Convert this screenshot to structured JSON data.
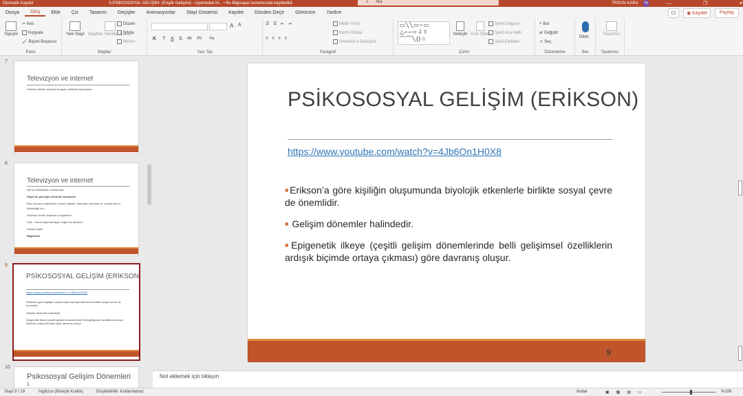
{
  "titlebar": {
    "autosave": "Otomatik Kaydet",
    "doc_title": "5.PSİKOSOSYAL GELİŞİM- (Erişilir Gelişimi) - Uyumluluk M... • Bu Bilgisayar konumunda kaydedildi",
    "search_placeholder": "Ara",
    "user": "TRSUN KARA",
    "avatar_initials": "TK",
    "window_controls": "—  ❐  ✕"
  },
  "menu": {
    "tabs": [
      "Dosya",
      "Giriş",
      "Ekle",
      "Çiz",
      "Tasarım",
      "Geçişler",
      "Animasyonlar",
      "Slayt Gösterisi",
      "Kaydet",
      "Gözden Geçir",
      "Görünüm",
      "Yardım"
    ],
    "active_index": 1,
    "comment_label": "☐",
    "record_label": "◉ Kaydet",
    "share_label": "Paylaş"
  },
  "ribbon": {
    "pano": {
      "label": "Pano",
      "paste": "Yapıştır",
      "cut": "Kes",
      "copy": "Kopyala",
      "format_painter": "Biçimi Boyacısı"
    },
    "slaytlar": {
      "label": "Slaytlar",
      "new_slide": "Yeni Slayt",
      "reuse": "Slaytları Yeniden Kullan",
      "layout": "Düzen",
      "reset": "Sıfırla",
      "section": "Bölüm"
    },
    "yazi_tipi": {
      "label": "Yazı Tipi",
      "font_size_up": "A",
      "font_size_down": "A",
      "bold": "K",
      "italic": "T",
      "underline": "A",
      "strike": "S",
      "shadow": "ab",
      "spacing": "AV",
      "case": "Aa"
    },
    "paragraf": {
      "label": "Paragraf",
      "text_direction": "Metin Yönü",
      "align_text": "Metni Hizala",
      "smartart": "SmartArt'a Dönüştür"
    },
    "cizim": {
      "label": "Çizim",
      "shapes": "▭╲╲▭○▭\n△⌐⌐⇨⇩⇧\n⌒⌒╲{}☆",
      "arrange": "Yerleştir",
      "quick_styles": "Hızlı Stiller",
      "shape_fill": "Şekil Dolgusu",
      "shape_outline": "Şekil Ana Hattı",
      "shape_effects": "Şekil Efektleri"
    },
    "duzenleme": {
      "label": "Düzenleme",
      "find": "Bul",
      "replace": "Değiştir",
      "select": "Seç"
    },
    "ses": {
      "label": "Ses",
      "dictate": "Dikte"
    },
    "tasarimci": {
      "label": "Tasarımcı",
      "designer": "Tasarımcı"
    }
  },
  "thumbnails": [
    {
      "number": "7",
      "title": "Televizyon ve internet",
      "lines": [
        "Yetersiz aktivite hareket olmayan etkileşim kavramları"
      ],
      "selected": false
    },
    {
      "number": "8",
      "title": "Televizyon ve internet",
      "lines": [
        "Aile içi etkileşimin sınırlanması",
        "Hayal ile gerçeğin zihninde karışması",
        "Bazı olumsuz eğitimlerin sınırsız (şiddet, stereotip, işmeyen vs. sosyal beceri düşüklüğü vb.)",
        "Olumsuz örnek oluşturan programlar",
        "Hızlı - Hazır hayat almayan doğurucu aktarımı",
        "Zaman kaybı",
        "Bağımlılık"
      ],
      "selected": false
    },
    {
      "number": "9",
      "title": "PSİKOSOSYAL GELİŞİM (ERİKSON)",
      "lines": [
        "https://www.youtube.com/watch?v=4Jb6On1H0X8",
        "Erikson'a göre kişiliğin oluşumunda biyolojik etkenlerle birlikte sosyal çevre de önemlidir.",
        "Gelişim dönemler halindedir.",
        "Epigenetik ilkeye (çeşitli gelişim dönemlerinde belli gelişimsel özelliklerin ardışık biçimde ortaya çıkması) göre davranış oluşur."
      ],
      "selected": true
    },
    {
      "number": "10",
      "title": "Psikososyal Gelişim Dönemleri",
      "lines": [
        "1"
      ],
      "selected": false
    }
  ],
  "slide": {
    "title": "PSİKOSOSYAL GELİŞİM (ERİKSON)",
    "link": "https://www.youtube.com/watch?v=4Jb6On1H0X8",
    "bullets": [
      "Erikson’a göre kişiliğin oluşumunda biyolojik etkenlerle birlikte sosyal çevre de önemlidir.",
      "Gelişim dönemler halindedir.",
      "Epigenetik ilkeye (çeşitli gelişim dönemlerinde belli gelişimsel özelliklerin ardışık biçimde ortaya çıkması) göre davranış oluşur."
    ],
    "page_number": "9"
  },
  "notes_placeholder": "Not eklemek için tıklayın",
  "status": {
    "slide_indicator": "Slayt 9 / 19",
    "language": "İngilizce (Birleşik Krallık)",
    "accessibility": "Erişilebilirlik: Kullanılamaz",
    "notes": "Notlar",
    "zoom": "%106"
  },
  "colors": {
    "accent": "#b7472a",
    "slide_bar": "#c0552b",
    "link": "#2e75b6"
  }
}
